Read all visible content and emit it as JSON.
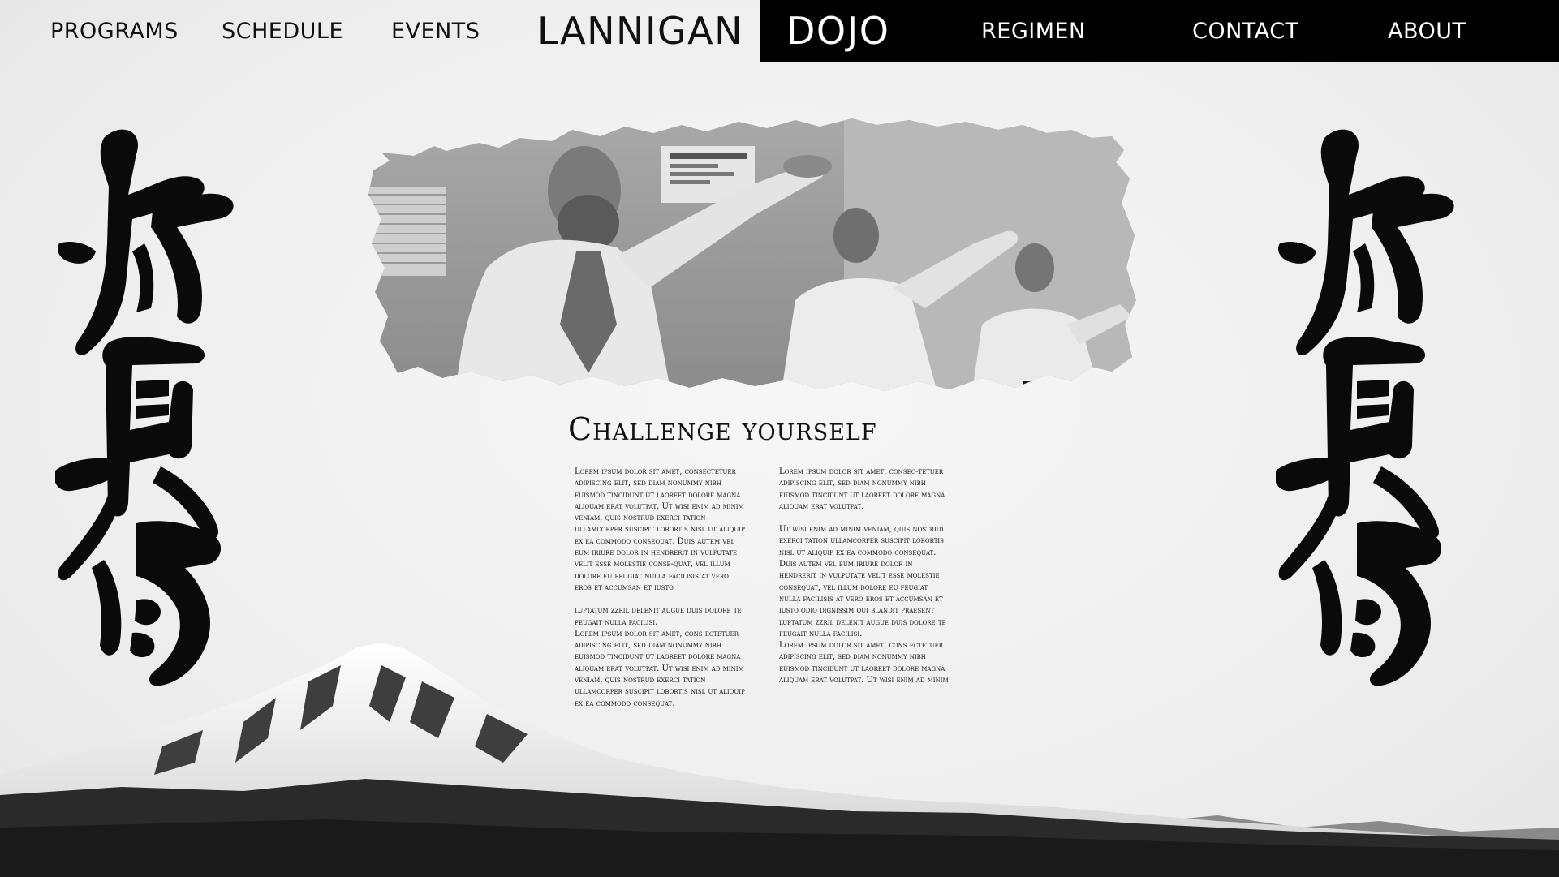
{
  "nav": {
    "left_items": [
      {
        "label": "PROGRAMS"
      },
      {
        "label": "SCHEDULE"
      },
      {
        "label": "EVENTS"
      }
    ],
    "brand_left": "LANNIGAN",
    "brand_right": "DOJO",
    "right_items": [
      {
        "label": "REGIMEN"
      },
      {
        "label": "CONTACT"
      },
      {
        "label": "ABOUT"
      }
    ]
  },
  "colors": {
    "nav_black": "#000000",
    "background": "#f1f1f1",
    "ink": "#111111"
  },
  "icons": {
    "calligraphy": "kyokushin-calligraphy",
    "photo": "karate-class-photo",
    "landscape": "snowy-mountain"
  },
  "main": {
    "heading": "Challenge yourself",
    "col1": [
      "Lorem ipsum dolor sit amet, consectetuer adipiscing elit, sed diam nonummy nibh euismod tincidunt ut laoreet dolore magna aliquam erat volutpat. Ut wisi enim ad minim veniam, quis nostrud exerci tation ullamcorper suscipit lobortis nisl ut aliquip ex ea commodo consequat. Duis autem vel eum iriure dolor in hendrerit in vulputate velit esse molestie conse-quat, vel illum dolore eu feugiat nulla facilisis at vero eros et accumsan et iusto",
      "luptatum zzril delenit augue duis dolore te feugait nulla facilisi.",
      "Lorem ipsum dolor sit amet, cons ectetuer adipiscing elit, sed diam nonummy nibh euismod tincidunt ut laoreet dolore magna aliquam erat volutpat. Ut wisi enim ad minim veniam, quis nostrud exerci tation ullamcorper suscipit lobortis nisl ut aliquip ex ea commodo consequat."
    ],
    "col2": [
      "Lorem ipsum dolor sit amet, consec-tetuer adipiscing elit, sed diam nonummy nibh euismod tincidunt ut laoreet dolore magna aliquam erat volutpat.",
      "Ut wisi enim ad minim veniam, quis nostrud exerci tation ullamcorper suscipit lobortis nisl ut aliquip ex ea commodo consequat. Duis autem vel eum iriure dolor in hendrerit in vulputate velit esse molestie consequat, vel illum dolore eu feugiat nulla facilisis at vero eros et accumsan et iusto odio dignissim qui blandit praesent luptatum zzril delenit augue duis dolore te feugait nulla facilisi.",
      "Lorem ipsum dolor sit amet, cons ectetuer adipiscing elit, sed diam nonummy nibh euismod tincidunt ut laoreet dolore magna aliquam erat volutpat. Ut wisi enim ad minim"
    ]
  }
}
